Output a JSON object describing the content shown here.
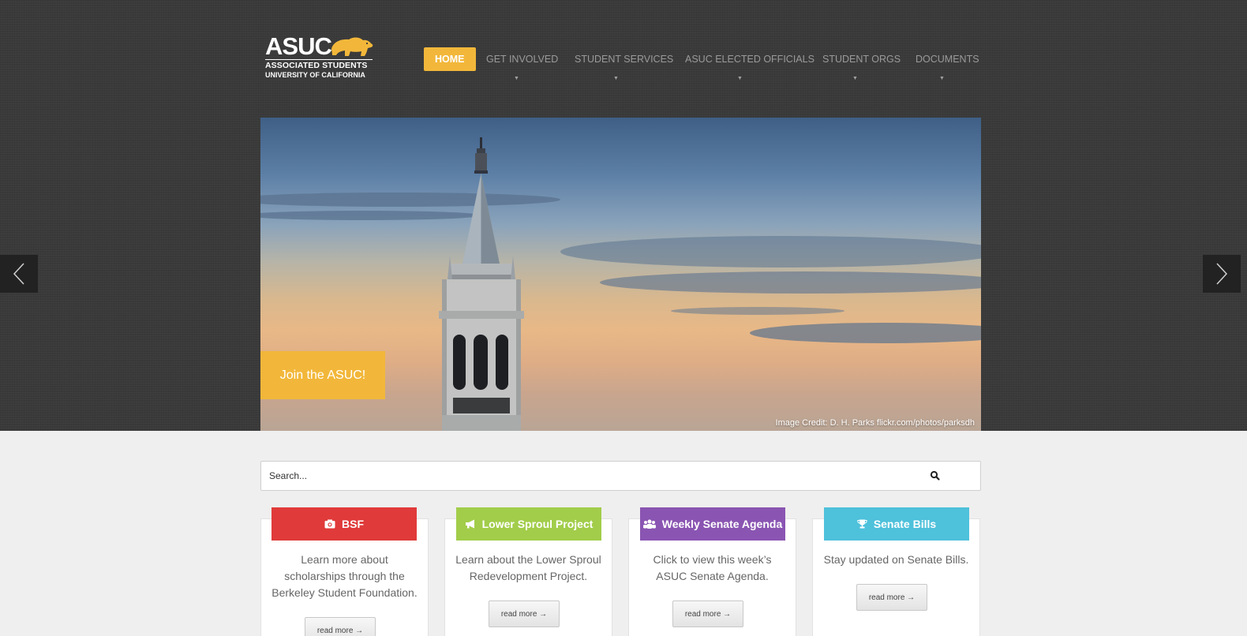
{
  "logo": {
    "word": "ASUC",
    "line1": "ASSOCIATED STUDENTS",
    "line2": "UNIVERSITY OF CALIFORNIA",
    "bear_color": "#f2b73a"
  },
  "nav": {
    "items": [
      {
        "label": "HOME",
        "active": true
      },
      {
        "label": "GET INVOLVED",
        "has_dropdown": true
      },
      {
        "label": "STUDENT SERVICES",
        "has_dropdown": true
      },
      {
        "label": "ASUC ELECTED OFFICIALS",
        "has_dropdown": true
      },
      {
        "label": "STUDENT ORGS",
        "has_dropdown": true
      },
      {
        "label": "DOCUMENTS",
        "has_dropdown": true
      }
    ],
    "caret": "▼"
  },
  "slider": {
    "cta_label": "Join the ASUC!",
    "credit": "Image Credit: D. H. Parks flickr.com/photos/parksdh",
    "prev_icon": "chevron-left-icon",
    "next_icon": "chevron-right-icon"
  },
  "search": {
    "placeholder": "Search...",
    "icon": "search-icon"
  },
  "cards": [
    {
      "title": "BSF",
      "icon": "camera-icon",
      "color": "#e03a3a",
      "text": "Learn more about scholarships through the Berkeley Student Foundation.",
      "button": "read more →"
    },
    {
      "title": "Lower Sproul Project",
      "icon": "bullhorn-icon",
      "color": "#a2cd4a",
      "text": "Learn about the Lower Sproul Redevelopment Project.",
      "button": "read more →"
    },
    {
      "title": "Weekly Senate Agenda",
      "icon": "group-icon",
      "color": "#8a55b2",
      "text": "Click to view this week’s ASUC Senate Agenda.",
      "button": "read more →"
    },
    {
      "title": "Senate Bills",
      "icon": "trophy-icon",
      "color": "#4ec1db",
      "text": "Stay updated on Senate Bills.",
      "button": "read more →"
    }
  ],
  "colors": {
    "accent": "#f2b73a",
    "header_bg": "#3a3a3a",
    "page_bg": "#efefef"
  }
}
